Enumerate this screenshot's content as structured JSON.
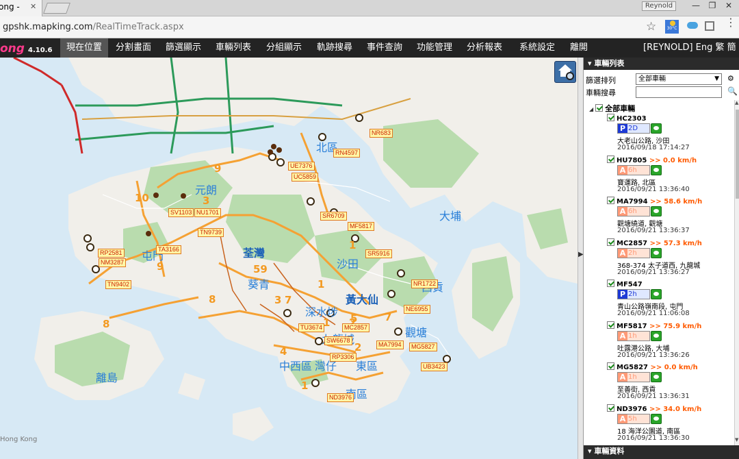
{
  "browser": {
    "tab_title": "ong - ",
    "tab_close": "✕",
    "user": "Reynold",
    "win_min": "—",
    "win_max": "❐",
    "win_close": "✕",
    "url_host": "gpshk.mapking.com",
    "url_path": "/RealTimeTrack.aspx",
    "star": "☆",
    "weather": "30°C",
    "menu": "⋮"
  },
  "app": {
    "logo": "ong",
    "version": "4.10.6",
    "nav": [
      {
        "label": "現在位置",
        "active": true
      },
      {
        "label": "分割畫面"
      },
      {
        "label": "篩選顯示"
      },
      {
        "label": "車輛列表"
      },
      {
        "label": "分組顯示"
      },
      {
        "label": "軌跡搜尋"
      },
      {
        "label": "事件查詢"
      },
      {
        "label": "功能管理"
      },
      {
        "label": "分析報表"
      },
      {
        "label": "系統設定"
      },
      {
        "label": "離開"
      }
    ],
    "user_info": "[REYNOLD] Eng 繁 簡"
  },
  "map": {
    "attribution": "Hong Kong",
    "districts": [
      "元朗",
      "北區",
      "大埔",
      "荃灣",
      "沙田",
      "葵青",
      "深水埗",
      "黃大仙",
      "屯門",
      "離島",
      "中西區",
      "灣仔",
      "東區",
      "西貢",
      "觀塘",
      "九龍城",
      "南區"
    ],
    "route_numbers": [
      "9",
      "10",
      "3",
      "59",
      "9",
      "8",
      "7",
      "3",
      "1",
      "1",
      "2",
      "5",
      "7",
      "2",
      "8",
      "4",
      "1",
      "1"
    ],
    "plates": [
      "RN4597",
      "NR683",
      "UE7376",
      "UC5859",
      "SV1103",
      "NU1701",
      "SR6709",
      "MF5817",
      "TN9739",
      "RP2581",
      "NM3287",
      "TA3166",
      "SR5916",
      "TN9402",
      "NR1722",
      "NE6955",
      "TU3674",
      "MC2857",
      "SW6678",
      "MA7994",
      "MG5827",
      "RP3306",
      "UB3423",
      "ND3976"
    ]
  },
  "panel": {
    "header": "車輛列表",
    "footer": "車輛資料",
    "filter_label": "篩選排列",
    "filter_value": "全部車輛",
    "search_label": "車輛搜尋",
    "search_value": "",
    "root_label": "全部車輛",
    "vehicles": [
      {
        "plate": "HC2303",
        "speed": "",
        "status": "P",
        "duration": "2D",
        "address": "大老山公路, 沙田",
        "time": "2016/09/18 17:14:27"
      },
      {
        "plate": "HU7805",
        "speed": ">> 0.0 km/h",
        "status": "A",
        "duration": "6h",
        "address": "寶運路, 北區",
        "time": "2016/09/21 13:36:40"
      },
      {
        "plate": "MA7994",
        "speed": ">> 58.6 km/h",
        "status": "A",
        "duration": "6h",
        "address": "觀塘繞道, 觀塘",
        "time": "2016/09/21 13:36:37"
      },
      {
        "plate": "MC2857",
        "speed": ">> 57.3 km/h",
        "status": "A",
        "duration": "2h",
        "address": "368-374 太子道西, 九龍城",
        "time": "2016/09/21 13:36:27"
      },
      {
        "plate": "MF547",
        "speed": "",
        "status": "P",
        "duration": "2h",
        "address": "青山公路嶺南段, 屯門",
        "time": "2016/09/21 11:06:08"
      },
      {
        "plate": "MF5817",
        "speed": ">> 75.9 km/h",
        "status": "A",
        "duration": "1h",
        "address": "吐露港公路, 大埔",
        "time": "2016/09/21 13:36:26"
      },
      {
        "plate": "MG5827",
        "speed": ">> 0.0 km/h",
        "status": "A",
        "duration": "1h",
        "address": "至善街, 西貢",
        "time": "2016/09/21 13:36:31"
      },
      {
        "plate": "ND3976",
        "speed": ">> 34.0 km/h",
        "status": "A",
        "duration": "5h",
        "address": "18 海洋公園道, 南區",
        "time": "2016/09/21 13:36:30"
      }
    ]
  }
}
